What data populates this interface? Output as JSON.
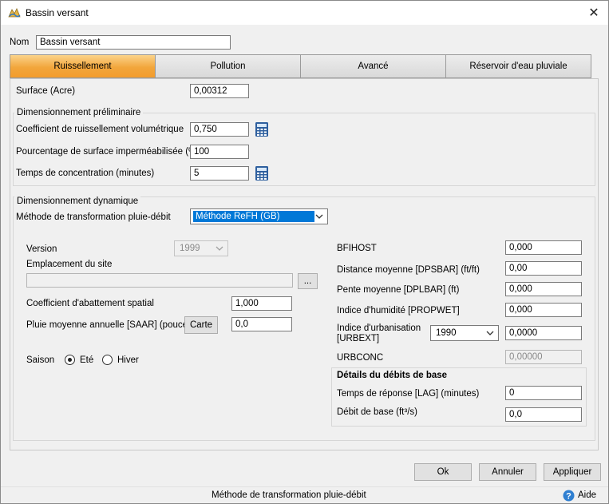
{
  "window": {
    "title": "Bassin versant",
    "close_glyph": "✕"
  },
  "name_field": {
    "label": "Nom",
    "value": "Bassin versant"
  },
  "tabs": [
    {
      "label": "Ruissellement",
      "active": true
    },
    {
      "label": "Pollution",
      "active": false
    },
    {
      "label": "Avancé",
      "active": false
    },
    {
      "label": "Réservoir d'eau pluviale",
      "active": false
    }
  ],
  "surface": {
    "label": "Surface (Acre)",
    "value": "0,00312"
  },
  "preliminary": {
    "title": "Dimensionnement préliminaire",
    "runoff_coeff": {
      "label": "Coefficient de ruissellement volumétrique",
      "value": "0,750",
      "icon": "calculator-icon"
    },
    "impervious_pct": {
      "label": "Pourcentage de surface imperméabilisée (%)",
      "value": "100"
    },
    "concentration_time": {
      "label": "Temps de concentration (minutes)",
      "value": "5",
      "icon": "calculator-icon"
    }
  },
  "dynamic": {
    "title": "Dimensionnement dynamique",
    "method": {
      "label": "Méthode de transformation pluie-débit",
      "value": "Méthode ReFH (GB)"
    },
    "version": {
      "label": "Version",
      "value": "1999"
    },
    "site_location": {
      "label": "Emplacement du site",
      "value": "",
      "browse_label": "..."
    },
    "spatial_reduction": {
      "label": "Coefficient d'abattement spatial",
      "value": "1,000"
    },
    "saar": {
      "label": "Pluie moyenne annuelle [SAAR] (pouce)",
      "map_button": "Carte",
      "value": "0,0"
    },
    "season": {
      "label": "Saison",
      "options": [
        {
          "label": "Eté",
          "selected": true
        },
        {
          "label": "Hiver",
          "selected": false
        }
      ]
    },
    "bfihost": {
      "label": "BFIHOST",
      "value": "0,000"
    },
    "dpsbar": {
      "label": "Distance moyenne [DPSBAR] (ft/ft)",
      "value": "0,00"
    },
    "dplbar": {
      "label": "Pente moyenne [DPLBAR] (ft)",
      "value": "0,000"
    },
    "propwet": {
      "label": "Indice d'humidité [PROPWET]",
      "value": "0,000"
    },
    "urbext": {
      "label_line1": "Indice d'urbanisation",
      "label_line2": "[URBEXT]",
      "year": "1990",
      "value": "0,0000"
    },
    "urbconc": {
      "label": "URBCONC",
      "value": "0,00000"
    },
    "baseflow": {
      "title": "Détails du débits de base",
      "lag": {
        "label": "Temps de réponse [LAG] (minutes)",
        "value": "0"
      },
      "base_flow": {
        "label": "Débit de base (ft³/s)",
        "value": "0,0"
      }
    }
  },
  "footer": {
    "ok": "Ok",
    "cancel": "Annuler",
    "apply": "Appliquer"
  },
  "statusbar": {
    "text": "Méthode de transformation pluie-débit",
    "help": "Aide"
  },
  "colors": {
    "active_tab": "#f39c2c",
    "selection": "#0078d7",
    "help_icon": "#2f7fd1"
  }
}
